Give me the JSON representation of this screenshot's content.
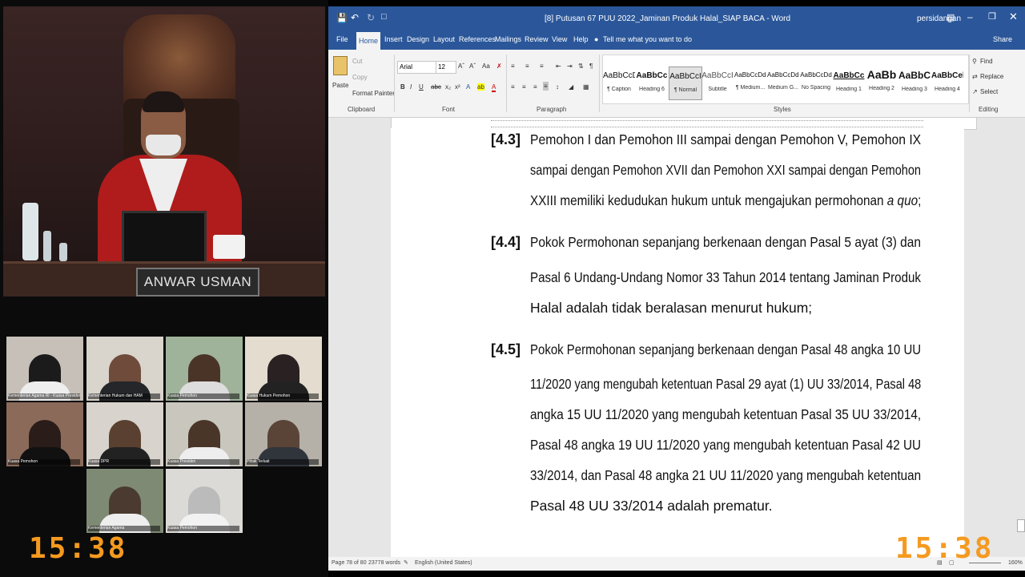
{
  "judge_video": {
    "nameplate": "ANWAR USMAN"
  },
  "participants": [
    {
      "label": "Kementerian Agama RI - Kuasa Presiden"
    },
    {
      "label": "Kementerian Hukum dan HAM"
    },
    {
      "label": "Kuasa Pemohon"
    },
    {
      "label": "Kuasa Hukum Pemohon"
    },
    {
      "label": "Kuasa Pemohon"
    },
    {
      "label": "Kuasa DPR"
    },
    {
      "label": "Kuasa Presiden"
    },
    {
      "label": "Pihak Terkait"
    },
    {
      "label": "Kementerian Agama"
    },
    {
      "label": "Kuasa Pemohon"
    }
  ],
  "clock_left": "15:38",
  "clock_right": "15:38",
  "word": {
    "title": "[8] Putusan 67 PUU 2022_Jaminan Produk Halal_SIAP BACA - Word",
    "user": "persidangan",
    "menu": [
      "File",
      "Home",
      "Insert",
      "Design",
      "Layout",
      "References",
      "Mailings",
      "Review",
      "View",
      "Help"
    ],
    "tell_me": "Tell me what you want to do",
    "share": "Share",
    "clipboard": {
      "paste": "Paste",
      "cut": "Cut",
      "copy": "Copy",
      "format_painter": "Format Painter",
      "label": "Clipboard"
    },
    "font": {
      "name": "Arial",
      "size": "12",
      "label": "Font"
    },
    "paragraph_label": "Paragraph",
    "styles": [
      {
        "sample": "AaBbCcDı",
        "name": "¶ Caption"
      },
      {
        "sample": "AaBbCc",
        "name": "Heading 6"
      },
      {
        "sample": "AaBbCcI",
        "name": "¶ Normal"
      },
      {
        "sample": "AaBbCcI",
        "name": "Subtitle"
      },
      {
        "sample": "AaBbCcDdI",
        "name": "¶ Medium..."
      },
      {
        "sample": "AaBbCcDdI",
        "name": "Medium G..."
      },
      {
        "sample": "AaBbCcDd",
        "name": "No Spacing"
      },
      {
        "sample": "AaBbCc",
        "name": "Heading 1"
      },
      {
        "sample": "AaBb",
        "name": "Heading 2"
      },
      {
        "sample": "AaBbC",
        "name": "Heading 3"
      },
      {
        "sample": "AaBbCel",
        "name": "Heading 4"
      }
    ],
    "styles_label": "Styles",
    "editing": {
      "find": "Find",
      "replace": "Replace",
      "select": "Select",
      "label": "Editing"
    },
    "document": [
      {
        "num": "[4.3]",
        "lines": [
          "Pemohon I dan Pemohon III sampai dengan Pemohon V, Pemohon IX",
          "sampai dengan Pemohon XVII dan Pemohon XXI sampai dengan Pemohon",
          "XXIII memiliki kedudukan hukum untuk mengajukan permohonan a quo;"
        ]
      },
      {
        "num": "[4.4]",
        "lines": [
          "Pokok Permohonan sepanjang  berkenaan dengan Pasal 5 ayat (3) dan",
          "Pasal 6 Undang-Undang Nomor 33 Tahun 2014 tentang Jaminan Produk",
          "Halal adalah tidak beralasan menurut hukum;"
        ]
      },
      {
        "num": "[4.5]",
        "lines": [
          "Pokok Permohonan sepanjang  berkenaan dengan Pasal 48 angka 10 UU",
          "11/2020 yang mengubah ketentuan Pasal 29 ayat (1) UU 33/2014, Pasal 48",
          "angka 15 UU 11/2020 yang mengubah ketentuan Pasal 35 UU 33/2014,",
          "Pasal 48 angka 19 UU 11/2020 yang mengubah ketentuan Pasal 42 UU",
          "33/2014, dan Pasal 48 angka 21 UU 11/2020 yang mengubah ketentuan",
          "Pasal 48 UU 33/2014 adalah prematur."
        ]
      }
    ],
    "status": {
      "page": "Page 78 of 80",
      "words": "23778 words",
      "language": "English (United States)",
      "zoom": "160%"
    }
  }
}
